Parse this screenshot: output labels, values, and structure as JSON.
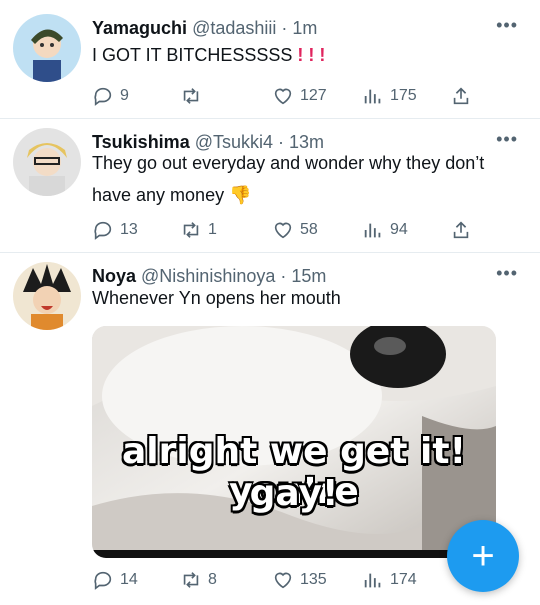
{
  "tweets": [
    {
      "name": "Yamaguchi",
      "handle": "@tadashiii",
      "time": "· 1m",
      "text": "I GOT IT BITCHESSSSS",
      "emoji": "! ! !",
      "replies": "9",
      "retweets": "",
      "likes": "127",
      "views": "175"
    },
    {
      "name": "Tsukishima",
      "handle": "@Tsukki4",
      "time": "· 13m",
      "text": "They go out everyday and wonder why they don’t have any money",
      "emoji": "👎",
      "replies": "13",
      "retweets": "1",
      "likes": "58",
      "views": "94"
    },
    {
      "name": "Noya",
      "handle": "@Nishinishinoya",
      "time": "· 15m",
      "text": "Whenever Yn opens her mouth",
      "replies": "14",
      "retweets": "8",
      "likes": "135",
      "views": "174",
      "media_text_line1": "alright we get it! you’re",
      "media_text_line2": "gay!"
    }
  ],
  "more_label": "•••",
  "fab_label": "+",
  "colors": {
    "accent": "#1d9bf0",
    "muted": "#536471",
    "divider": "#e6ecf0"
  }
}
